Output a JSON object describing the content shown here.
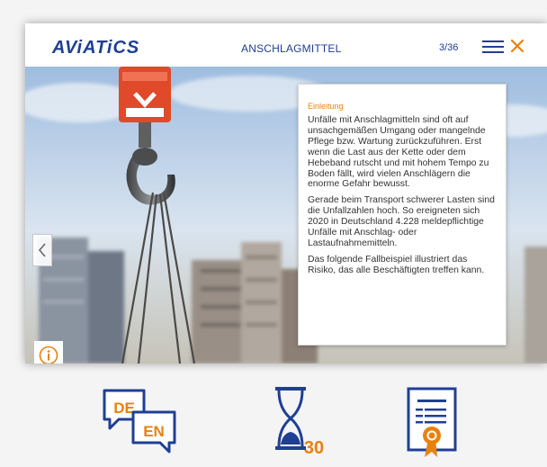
{
  "header": {
    "logo": "AViATiCS",
    "title": "ANSCHLAGMITTEL",
    "page": "3/36",
    "menu_icon": "hamburger-menu-icon",
    "close_icon": "close-icon"
  },
  "colors": {
    "brand_blue": "#1f3f94",
    "accent_orange": "#e9810e"
  },
  "card": {
    "heading": "Einleitung",
    "paragraphs": [
      "Unfälle mit Anschlagmitteln sind oft auf unsachgemäßen Umgang oder mangelnde Pflege bzw. Wartung zurückzuführen. Erst wenn die Last aus der Kette oder dem Hebeband rutscht und mit hohem Tempo zu Boden fällt, wird vielen Anschlägern die enorme Gefahr bewusst.",
      "Gerade beim Transport schwerer Lasten sind die Unfallzahlen hoch. So ereigneten sich 2020 in Deutschland 4.228 meldepflichtige Unfälle mit Anschlag- oder Lastaufnahmemitteln.",
      "Das folgende Fallbeispiel illustriert das Risiko, das alle Beschäftigten treffen kann."
    ]
  },
  "nav": {
    "prev_icon": "chevron-left-icon",
    "info_icon": "info-icon"
  },
  "tools": {
    "language": {
      "icon": "language-switch-icon",
      "from": "DE",
      "to": "EN"
    },
    "timer": {
      "icon": "hourglass-icon",
      "value": "30"
    },
    "certificate": {
      "icon": "certificate-icon"
    }
  }
}
